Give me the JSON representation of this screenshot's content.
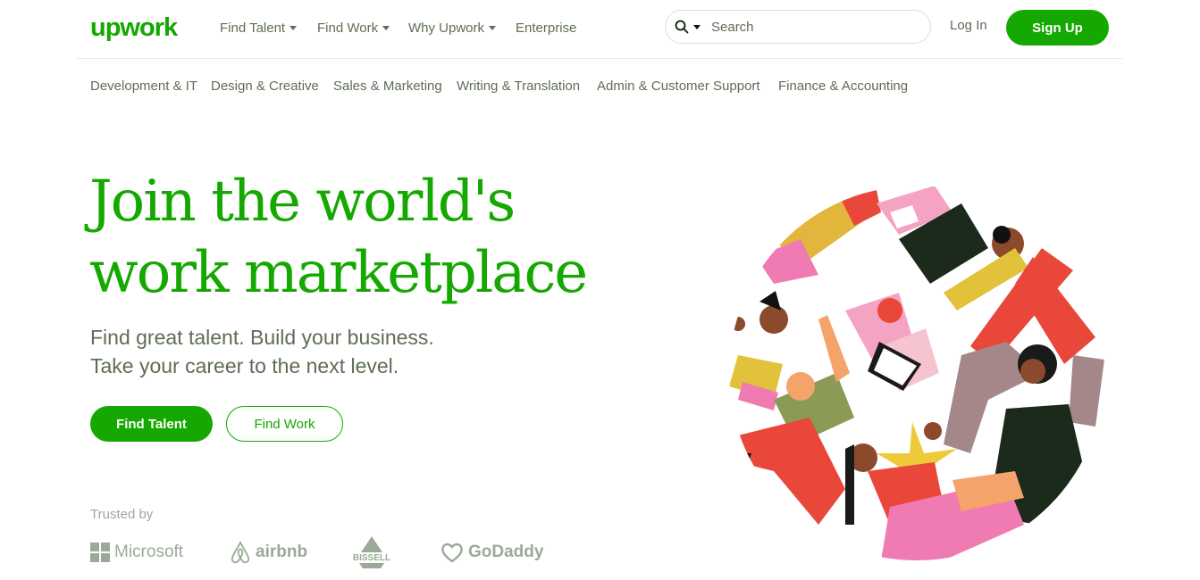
{
  "header": {
    "logo_text": "upwork",
    "nav": [
      {
        "label": "Find Talent",
        "has_dropdown": true
      },
      {
        "label": "Find Work",
        "has_dropdown": true
      },
      {
        "label": "Why Upwork",
        "has_dropdown": true
      },
      {
        "label": "Enterprise",
        "has_dropdown": false
      }
    ],
    "search": {
      "placeholder": "Search"
    },
    "login_label": "Log In",
    "signup_label": "Sign Up"
  },
  "categories": [
    "Development & IT",
    "Design & Creative",
    "Sales & Marketing",
    "Writing & Translation",
    "Admin & Customer Support",
    "Finance & Accounting"
  ],
  "hero": {
    "title_line1": "Join the world's",
    "title_line2": "work marketplace",
    "subtitle_line1": "Find great talent. Build your business.",
    "subtitle_line2": "Take your career to the next level.",
    "find_talent_label": "Find Talent",
    "find_work_label": "Find Work"
  },
  "trusted": {
    "label": "Trusted by",
    "brands": [
      "Microsoft",
      "airbnb",
      "BISSELL",
      "GoDaddy"
    ]
  },
  "colors": {
    "brand_green": "#14a800",
    "text_gray": "#5e6d55",
    "muted_gray": "#9aaa97"
  }
}
